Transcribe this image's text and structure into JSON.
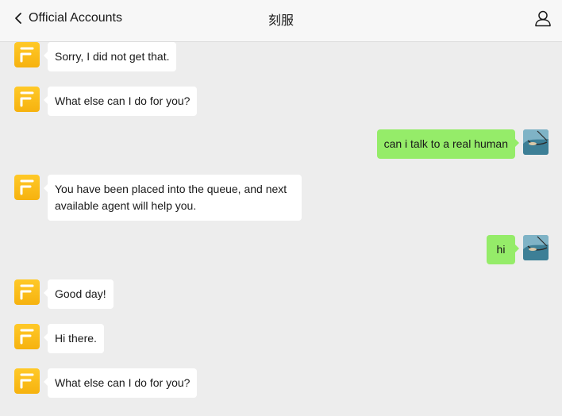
{
  "header": {
    "back_label": "Official Accounts",
    "title": "刻服"
  },
  "messages": [
    {
      "side": "left",
      "text": "Sorry, I did not get that."
    },
    {
      "side": "left",
      "text": "What else can I do for you?"
    },
    {
      "side": "right",
      "text": "can i talk to a real human"
    },
    {
      "side": "left",
      "text": "You have been placed into the queue, and next available agent will help you."
    },
    {
      "side": "right",
      "text": "hi"
    },
    {
      "side": "left",
      "text": "Good day!"
    },
    {
      "side": "left",
      "text": "Hi there."
    },
    {
      "side": "left",
      "text": "What else can I do for you?"
    }
  ],
  "colors": {
    "sent_bubble": "#95ec69",
    "received_bubble": "#ffffff",
    "bot_avatar": "#f6b20f",
    "background": "#ededed"
  },
  "icons": {
    "back": "chevron-left-icon",
    "profile": "person-icon",
    "bot_avatar": "bot-logo-icon"
  }
}
